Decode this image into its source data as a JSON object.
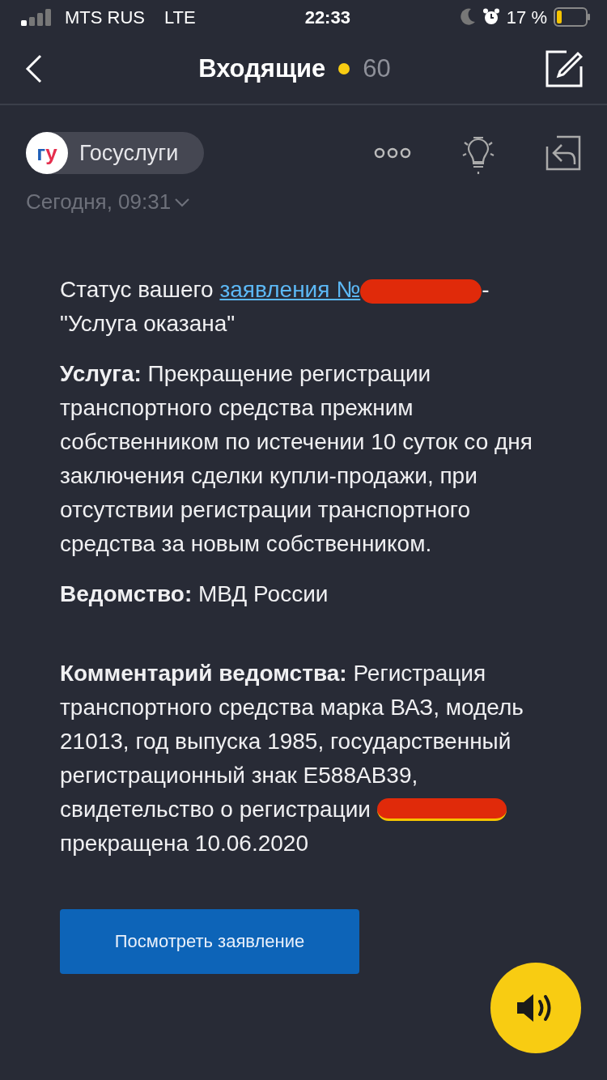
{
  "status_bar": {
    "carrier": "MTS RUS",
    "network": "LTE",
    "time": "22:33",
    "battery": "17 %"
  },
  "header": {
    "title": "Входящие",
    "unread_count": "60"
  },
  "message": {
    "sender": "Госуслуги",
    "sender_logo": "гу",
    "date": "Сегодня, 09:31",
    "status": {
      "prefix": "Статус вашего",
      "link": "заявления №",
      "suffix": "-",
      "status_text": "\"Услуга оказана\""
    },
    "paragraphs": [
      "**Услуга:** Прекращение регистрации транспортного средства прежним собственником по истечении 10 суток со дня заключения сделки купли-продажи, при отсутствии регистрации транспортного средства за новым собственником.",
      "**Ведомство:** МВД России"
    ],
    "comment": {
      "before": "**Комментарий ведомства:** Регистрация транспортного средства марка ВАЗ, модель 21013, год выпуска 1985, государственный регистрационный знак Е588АВ39,",
      "certificate_label": "свидетельство о регистрации",
      "after": "прекращена 10.06.2020"
    },
    "button": "Посмотреть заявление"
  }
}
